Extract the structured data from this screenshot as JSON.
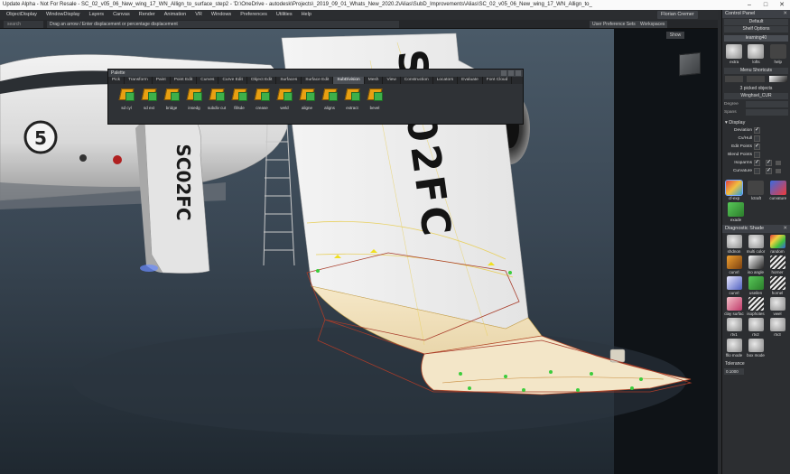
{
  "window": {
    "title": "Update Alpha - Not For Resale  - SC_02_v05_06_New_wing_17_WN_Allign_to_surface_step2 - 'D:\\OneDrive - autodesk\\Projects\\_2019_09_01_Whats_New_2020.2\\Alias\\SubD_Improvements\\Alias\\SC_02_v05_06_New_wing_17_WN_Allign_to_",
    "min_icon": "minimize-icon",
    "max_icon": "maximize-icon",
    "close_icon": "close-icon"
  },
  "menu": [
    "ObjectDisplay",
    "WindowDisplay",
    "Layers",
    "Canvas",
    "Render",
    "Animation",
    "VR",
    "Windows",
    "Preferences",
    "Utilities",
    "Help"
  ],
  "user": "Florian Cremer",
  "prompt": {
    "left_field": "search",
    "text": "Drag an arrow / Enter displacement or percentage displacement",
    "user_prefs": "User Preference Sets",
    "workspaces": "Workspaces"
  },
  "viewport": {
    "show_label": "Show",
    "nose_number": "5",
    "wing_text": "SC02FC",
    "tail_text": "SC02FC"
  },
  "palette": {
    "title": "Palette",
    "tabs": [
      "Pick",
      "Transform",
      "Paint",
      "Point Edit",
      "Curves",
      "Curve Edit",
      "Object Edit",
      "Surfaces",
      "Surface Edit",
      "SubDivision",
      "Mesh",
      "View",
      "Construction",
      "Locators",
      "Evaluate",
      "Font Cloud"
    ],
    "active_tab": 9,
    "tools": [
      {
        "label": "sd cyl"
      },
      {
        "label": "sd ext"
      },
      {
        "label": "bridge"
      },
      {
        "label": "insedg"
      },
      {
        "label": "subdiv cut"
      },
      {
        "label": "fillsde"
      },
      {
        "label": "crease"
      },
      {
        "label": "weld"
      },
      {
        "label": "aligne"
      },
      {
        "label": "aligns"
      },
      {
        "label": "extract"
      },
      {
        "label": "bevel"
      }
    ]
  },
  "control_panel": {
    "title": "Control Panel",
    "default_combo": "Default",
    "shelf_options": "Shelf Options",
    "shelf_name": "learning40",
    "shelf_tools": [
      {
        "label": "extra",
        "icon": "extra-tool-icon"
      },
      {
        "label": "lofts",
        "icon": "lofts-tool-icon"
      },
      {
        "label": "help",
        "icon": "help-icon"
      }
    ],
    "menu_shortcuts": "Menu Shortcuts",
    "picked_objects": "3 picked objects",
    "picked_name": "Winghsel_CUR",
    "degree_label": "Degree",
    "spans_label": "Spans",
    "display_head": "Display",
    "display_rows": [
      {
        "label": "Deviation",
        "checked": "✓",
        "second": ""
      },
      {
        "label": "Cv/Hull",
        "checked": "",
        "second": ""
      },
      {
        "label": "Edit Points",
        "checked": "✓",
        "second": ""
      },
      {
        "label": "Blend Points",
        "checked": "",
        "second": ""
      },
      {
        "label": "Isoparms",
        "checked": "✓",
        "second": "✓"
      },
      {
        "label": "Curvature",
        "checked": "",
        "second": "✓"
      }
    ],
    "eval_tools": [
      {
        "label": "cf-exp",
        "icon": "curvature-flow-icon"
      },
      {
        "label": "lctraft",
        "icon": "lctraft-icon"
      },
      {
        "label": "curvature",
        "icon": "curvature-icon"
      }
    ],
    "extra_tool": {
      "label": "exade",
      "icon": "exade-tool-icon"
    },
    "diagnostic": {
      "title": "Diagnostic Shade",
      "items": [
        {
          "label": "shdnon",
          "style": "gray"
        },
        {
          "label": "multi color",
          "style": "gray"
        },
        {
          "label": "random",
          "style": "rainbow"
        },
        {
          "label": "curvrl",
          "style": "orange"
        },
        {
          "label": "iso angle",
          "style": "mono"
        },
        {
          "label": "horner",
          "style": "stripe"
        },
        {
          "label": "curvrl",
          "style": "blue"
        },
        {
          "label": "useilen",
          "style": "green"
        },
        {
          "label": "hornel",
          "style": "stripe"
        },
        {
          "label": "clay surfac",
          "style": "pink"
        },
        {
          "label": "isophotes",
          "style": "stripe"
        },
        {
          "label": "vwel",
          "style": "gray"
        },
        {
          "label": "rtv1",
          "style": "gray"
        },
        {
          "label": "rtv2",
          "style": "gray"
        },
        {
          "label": "rtv3",
          "style": "gray"
        },
        {
          "label": "fllo mode",
          "style": "gray"
        },
        {
          "label": "box mode",
          "style": "gray"
        }
      ]
    },
    "tolerance_label": "Tolerance",
    "tolerance_value": "0.1000"
  }
}
